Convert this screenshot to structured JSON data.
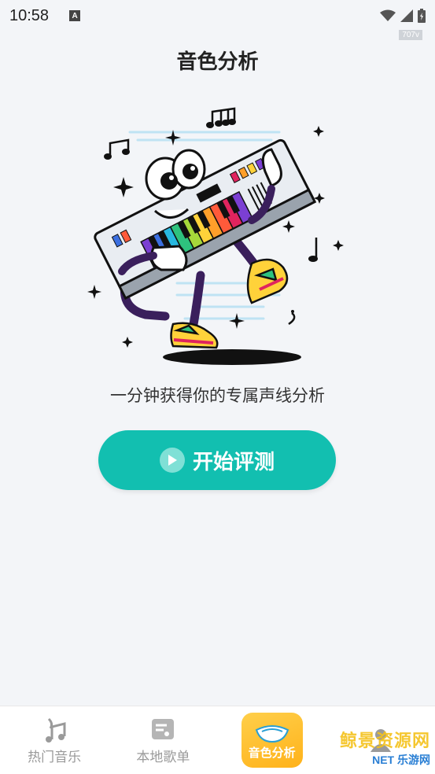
{
  "status_bar": {
    "time": "10:58",
    "badge": "A",
    "icons": [
      "wifi-icon",
      "signal-icon",
      "battery-icon"
    ]
  },
  "watermark_top": "707v",
  "page": {
    "title": "音色分析",
    "subtitle": "一分钟获得你的专属声线分析"
  },
  "start_button": {
    "label": "开始评测",
    "color": "#12bfb0"
  },
  "bottom_nav": {
    "items": [
      {
        "label": "热门音乐",
        "icon": "music-note-icon"
      },
      {
        "label": "本地歌单",
        "icon": "playlist-icon"
      },
      {
        "label": "音色分析",
        "icon": "voice-analysis-icon",
        "active": true
      },
      {
        "label": "我的",
        "icon": "user-icon"
      }
    ]
  },
  "watermark_bottom": {
    "line1": "鲸景资源网",
    "line2": "NET 乐游网"
  }
}
